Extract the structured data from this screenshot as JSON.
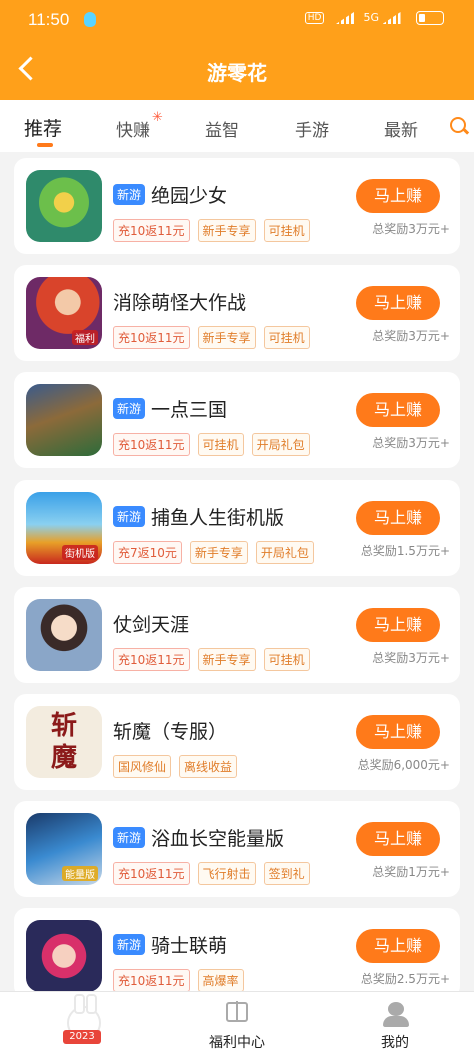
{
  "status_bar": {
    "time": "11:50",
    "network": "HD",
    "signal2": "5G"
  },
  "header": {
    "title": "游零花"
  },
  "tabs": [
    {
      "label": "推荐",
      "active": true
    },
    {
      "label": "快赚",
      "active": false
    },
    {
      "label": "益智",
      "active": false
    },
    {
      "label": "手游",
      "active": false
    },
    {
      "label": "最新",
      "active": false
    }
  ],
  "games": [
    {
      "name": "绝园少女",
      "is_new": true,
      "new_label": "新游",
      "tags": [
        "充10返11元",
        "新手专享",
        "可挂机"
      ],
      "button": "马上赚",
      "reward": "总奖励3万元+"
    },
    {
      "name": "消除萌怪大作战",
      "is_new": false,
      "new_label": "",
      "tags": [
        "充10返11元",
        "新手专享",
        "可挂机"
      ],
      "button": "马上赚",
      "reward": "总奖励3万元+"
    },
    {
      "name": "一点三国",
      "is_new": true,
      "new_label": "新游",
      "tags": [
        "充10返11元",
        "可挂机",
        "开局礼包"
      ],
      "button": "马上赚",
      "reward": "总奖励3万元+"
    },
    {
      "name": "捕鱼人生街机版",
      "is_new": true,
      "new_label": "新游",
      "tags": [
        "充7返10元",
        "新手专享",
        "开局礼包"
      ],
      "button": "马上赚",
      "reward": "总奖励1.5万元+"
    },
    {
      "name": "仗剑天涯",
      "is_new": false,
      "new_label": "",
      "tags": [
        "充10返11元",
        "新手专享",
        "可挂机"
      ],
      "button": "马上赚",
      "reward": "总奖励3万元+"
    },
    {
      "name": "斩魔（专服）",
      "is_new": false,
      "new_label": "",
      "tags": [
        "国风修仙",
        "离线收益"
      ],
      "button": "马上赚",
      "reward": "总奖励6,000元+"
    },
    {
      "name": "浴血长空能量版",
      "is_new": true,
      "new_label": "新游",
      "tags": [
        "充10返11元",
        "飞行射击",
        "签到礼"
      ],
      "button": "马上赚",
      "reward": "总奖励1万元+"
    },
    {
      "name": "骑士联萌",
      "is_new": true,
      "new_label": "新游",
      "tags": [
        "充10返11元",
        "高爆率"
      ],
      "button": "马上赚",
      "reward": "总奖励2.5万元+"
    }
  ],
  "icon_labels": {
    "g2": "福利",
    "g4": "街机版",
    "g6": "斩魔",
    "g7": "能量版"
  },
  "bottom_nav": {
    "home_year": "2023",
    "welfare": "福利中心",
    "mine": "我的"
  },
  "colors": {
    "brand": "#ffa01a",
    "button": "#ff7a1a",
    "new_badge": "#3a8bff"
  }
}
